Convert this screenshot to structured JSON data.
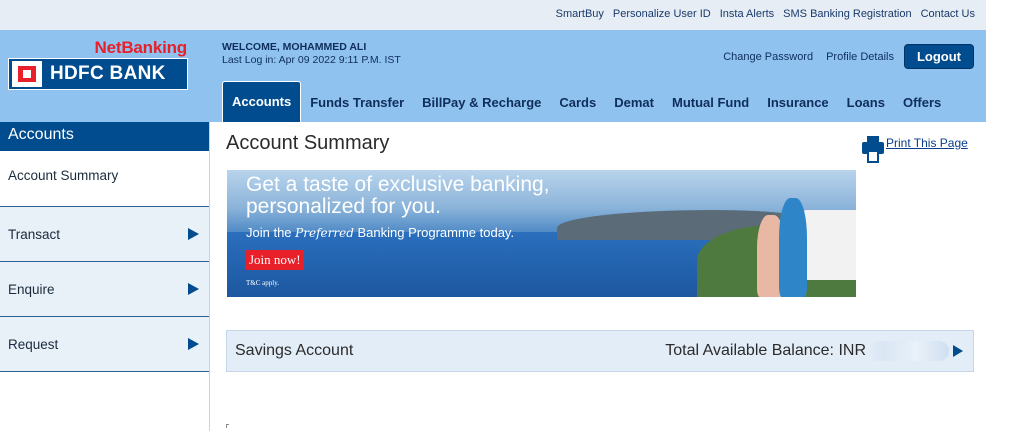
{
  "util_links": [
    "SmartBuy",
    "Personalize User ID",
    "Insta Alerts",
    "SMS Banking Registration",
    "Contact Us"
  ],
  "logo": {
    "netbanking": "NetBanking",
    "bank": "HDFC BANK"
  },
  "welcome": {
    "name_line": "WELCOME, MOHAMMED ALI",
    "last_login": "Last Log in: Apr 09 2022 9:11 P.M. IST"
  },
  "header_actions": {
    "change_password": "Change Password",
    "profile_details": "Profile Details",
    "logout": "Logout"
  },
  "tabs": [
    "Accounts",
    "Funds Transfer",
    "BillPay & Recharge",
    "Cards",
    "Demat",
    "Mutual Fund",
    "Insurance",
    "Loans",
    "Offers"
  ],
  "active_tab": "Accounts",
  "sidebar": {
    "title": "Accounts",
    "items": [
      "Account Summary",
      "Transact",
      "Enquire",
      "Request"
    ]
  },
  "main": {
    "title": "Account Summary",
    "print_label": "Print This Page"
  },
  "banner": {
    "headline": "Get a taste of exclusive banking, personalized for you.",
    "line_prefix": "Join the",
    "preferred": "Preferred",
    "line_suffix": "Banking Programme today.",
    "button": "Join now!",
    "tc": "T&C apply."
  },
  "account": {
    "name": "Savings Account",
    "balance_label": "Total Available Balance: INR"
  },
  "colors": {
    "brand_blue": "#004c8f",
    "header_bg": "#8fc2ef",
    "brand_red": "#e8202a"
  }
}
